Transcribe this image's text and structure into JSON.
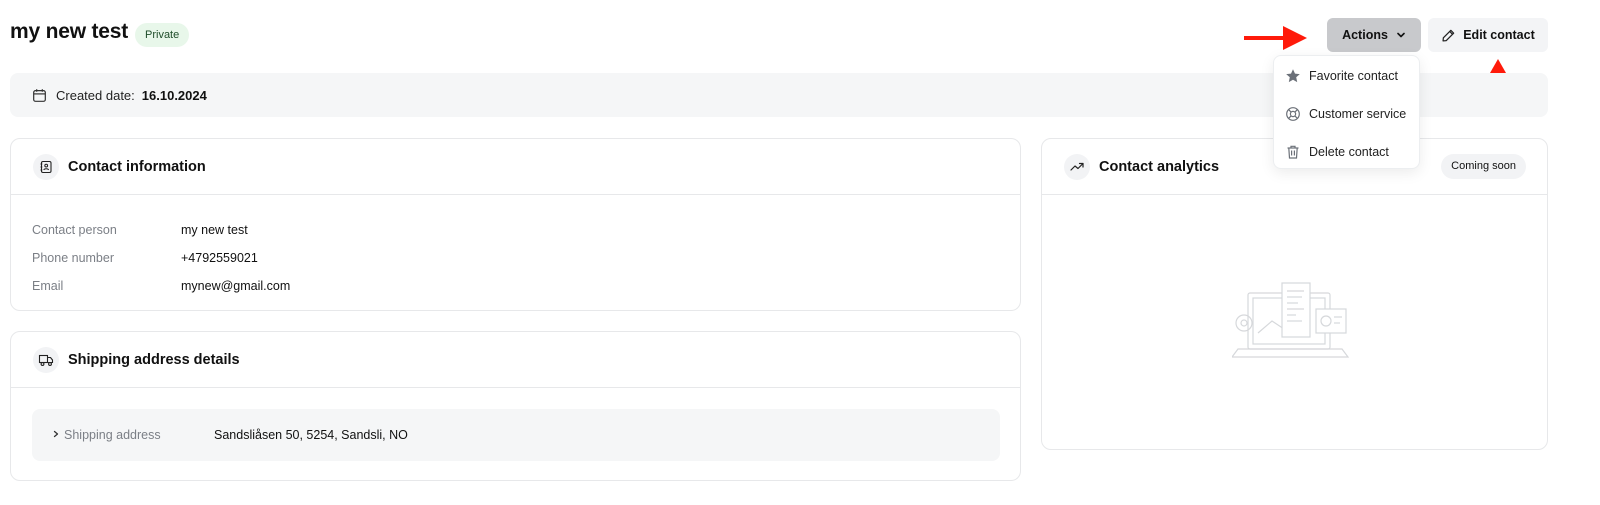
{
  "header": {
    "title": "my new test",
    "badge": "Private",
    "actions_label": "Actions",
    "edit_label": "Edit contact"
  },
  "meta": {
    "created_label": "Created date:",
    "created_value": "16.10.2024"
  },
  "dropdown": {
    "items": [
      {
        "label": "Favorite contact",
        "icon": "star-icon"
      },
      {
        "label": "Customer service",
        "icon": "lifebuoy-icon"
      },
      {
        "label": "Delete contact",
        "icon": "trash-icon"
      }
    ]
  },
  "contact_info": {
    "title": "Contact information",
    "rows": [
      {
        "label": "Contact person",
        "value": "my new test"
      },
      {
        "label": "Phone number",
        "value": "+4792559021"
      },
      {
        "label": "Email",
        "value": "mynew@gmail.com"
      }
    ]
  },
  "shipping": {
    "title": "Shipping address details",
    "label": "Shipping address",
    "value": "Sandsliåsen 50, 5254, Sandsli, NO"
  },
  "analytics": {
    "title": "Contact analytics",
    "badge": "Coming soon"
  },
  "colors": {
    "annotation_arrow": "#ff1a0a",
    "private_badge_bg": "#e8f7ea",
    "actions_button_bg": "#c8c9cc"
  }
}
